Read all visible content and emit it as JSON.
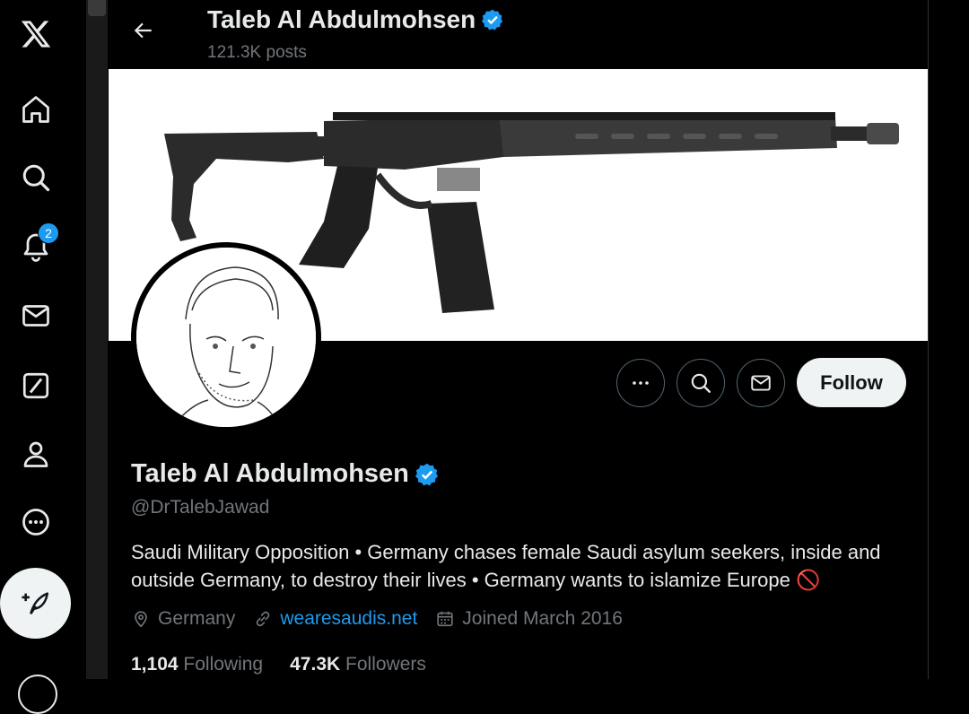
{
  "header": {
    "name": "Taleb Al Abdulmohsen",
    "posts": "121.3K posts"
  },
  "nav": {
    "icons": [
      "x-logo-icon",
      "home-icon",
      "search-icon",
      "notifications-icon",
      "messages-icon",
      "grok-icon",
      "profile-icon",
      "more-icon",
      "compose-icon"
    ],
    "notification_count": "2"
  },
  "profile": {
    "name": "Taleb Al Abdulmohsen",
    "handle": "@DrTalebJawad",
    "bio": "Saudi Military Opposition • Germany chases female Saudi asylum seekers, inside and outside Germany, to destroy their lives • Germany wants to islamize Europe",
    "bio_emoji": "🚫",
    "location": "Germany",
    "website": "wearesaudis.net",
    "joined": "Joined March 2016",
    "following_count": "1,104",
    "following_label": "Following",
    "followers_count": "47.3K",
    "followers_label": "Followers"
  },
  "actions": {
    "follow_label": "Follow"
  },
  "colors": {
    "accent": "#1d9bf0",
    "background": "#000000",
    "muted": "#71767b",
    "text": "#e7e9ea"
  }
}
